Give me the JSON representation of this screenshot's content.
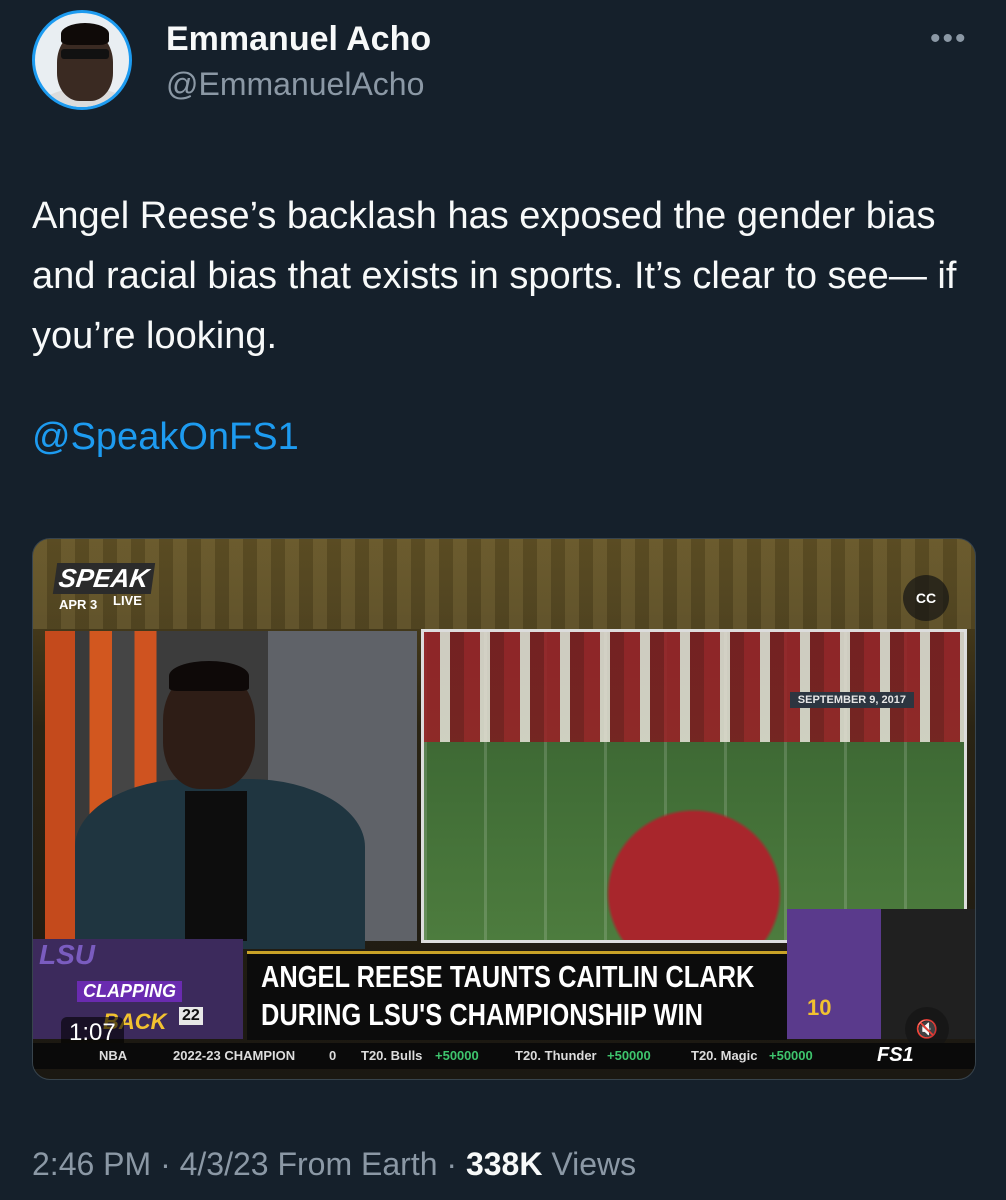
{
  "author": {
    "name": "Emmanuel Acho",
    "handle": "@EmmanuelAcho"
  },
  "more_icon": "more-horizontal-icon",
  "tweet": {
    "text": "Angel Reese’s backlash has exposed the gender bias and racial bias that exists in sports. It’s clear to see— if you’re looking.",
    "mention": "@SpeakOnFS1"
  },
  "video": {
    "show_logo": "SPEAK",
    "show_date": "APR 3",
    "show_live": "LIVE",
    "cc_label": "CC",
    "field_date": "SEPTEMBER 9, 2017",
    "lower_third": {
      "lsu": "LSU",
      "clapping": "CLAPPING",
      "back": "BACK",
      "jersey": "22",
      "headline_1": "ANGEL REESE TAUNTS CAITLIN CLARK",
      "headline_2": "DURING LSU'S CHAMPIONSHIP WIN",
      "player_number": "10"
    },
    "duration": "1:07",
    "ticker": {
      "league": "NBA",
      "item1": "2022-23 CHAMPION",
      "item1_value": "0",
      "item2": "T20. Bulls",
      "item2_value": "+50000",
      "item3": "T20. Thunder",
      "item3_value": "+50000",
      "item4": "T20. Magic",
      "item4_value": "+50000",
      "network": "FS1"
    }
  },
  "meta": {
    "time": "2:46 PM",
    "date": "4/3/23",
    "source": "From Earth",
    "views_count": "338K",
    "views_label": "Views"
  },
  "colors": {
    "background": "#15202b",
    "link": "#1d9bf0",
    "muted": "#8b98a5"
  }
}
